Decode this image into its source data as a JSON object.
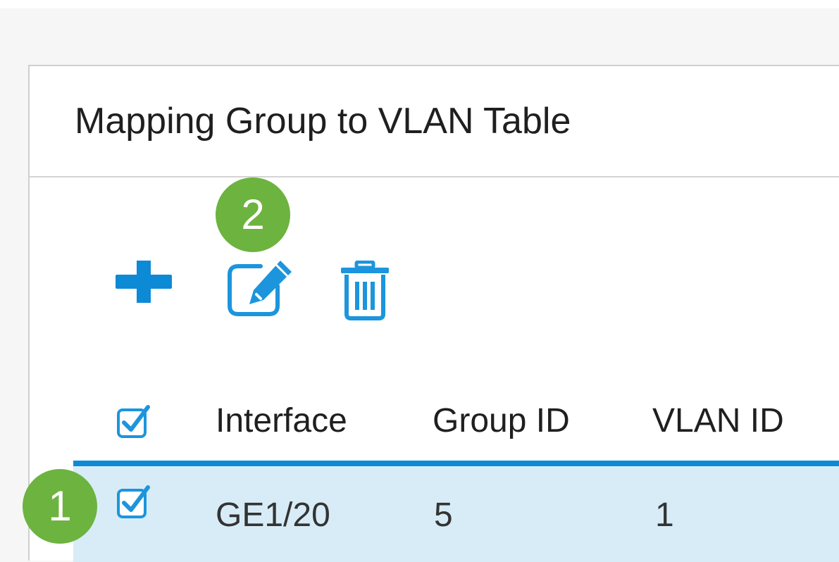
{
  "panel": {
    "title": "Mapping Group to VLAN Table"
  },
  "toolbar": {
    "add_icon": "plus-icon",
    "edit_icon": "edit-icon",
    "delete_icon": "trash-icon"
  },
  "callouts": {
    "first": "1",
    "second": "2"
  },
  "table": {
    "columns": [
      "Interface",
      "Group ID",
      "VLAN ID"
    ],
    "header_checkbox_checked": true,
    "rows": [
      {
        "checked": true,
        "interface": "GE1/20",
        "group_id": "5",
        "vlan_id": "1",
        "selected": true
      }
    ]
  },
  "colors": {
    "accent": "#0d8ad6",
    "callout": "#6db33f",
    "selected_row": "#d7ecf7"
  }
}
